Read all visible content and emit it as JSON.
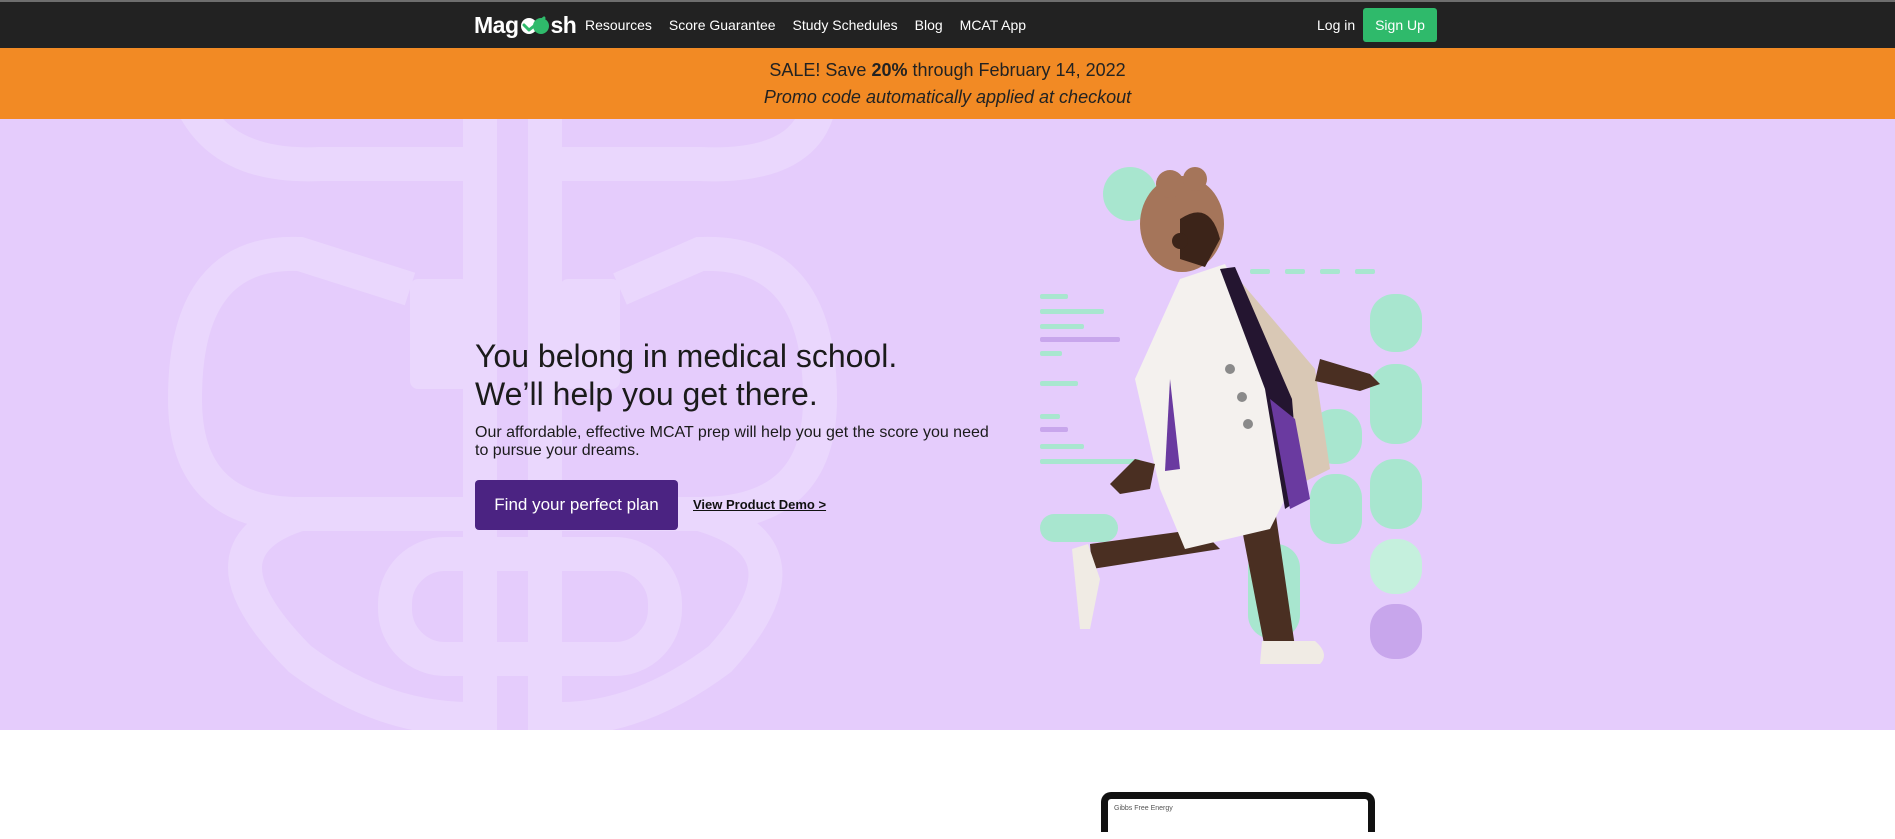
{
  "nav": {
    "logo": "Magoosh",
    "links": [
      "Resources",
      "Score Guarantee",
      "Study Schedules",
      "Blog",
      "MCAT App"
    ],
    "login": "Log in",
    "signup": "Sign Up"
  },
  "promo": {
    "sale_prefix": "SALE! Save ",
    "sale_percent": "20%",
    "sale_suffix": " through February 14, 2022",
    "note": "Promo code automatically applied at checkout"
  },
  "hero": {
    "headline_line1": "You belong in medical school.",
    "headline_line2": "We’ll help you get there.",
    "subtext": "Our affordable, effective MCAT prep will help you get the score you need to pursue your dreams.",
    "cta": "Find your perfect plan",
    "demo_link": "View Product Demo >"
  },
  "preview": {
    "caption": "Gibbs Free Energy"
  },
  "colors": {
    "nav_bg": "#222222",
    "promo_bg": "#f28a24",
    "hero_bg": "#e5ccfc",
    "cta_bg": "#4b2382",
    "signup_bg": "#2fba6b"
  },
  "icons": [
    "magoosh-checkmark-icon",
    "caduceus-background",
    "doctor-illustration"
  ]
}
